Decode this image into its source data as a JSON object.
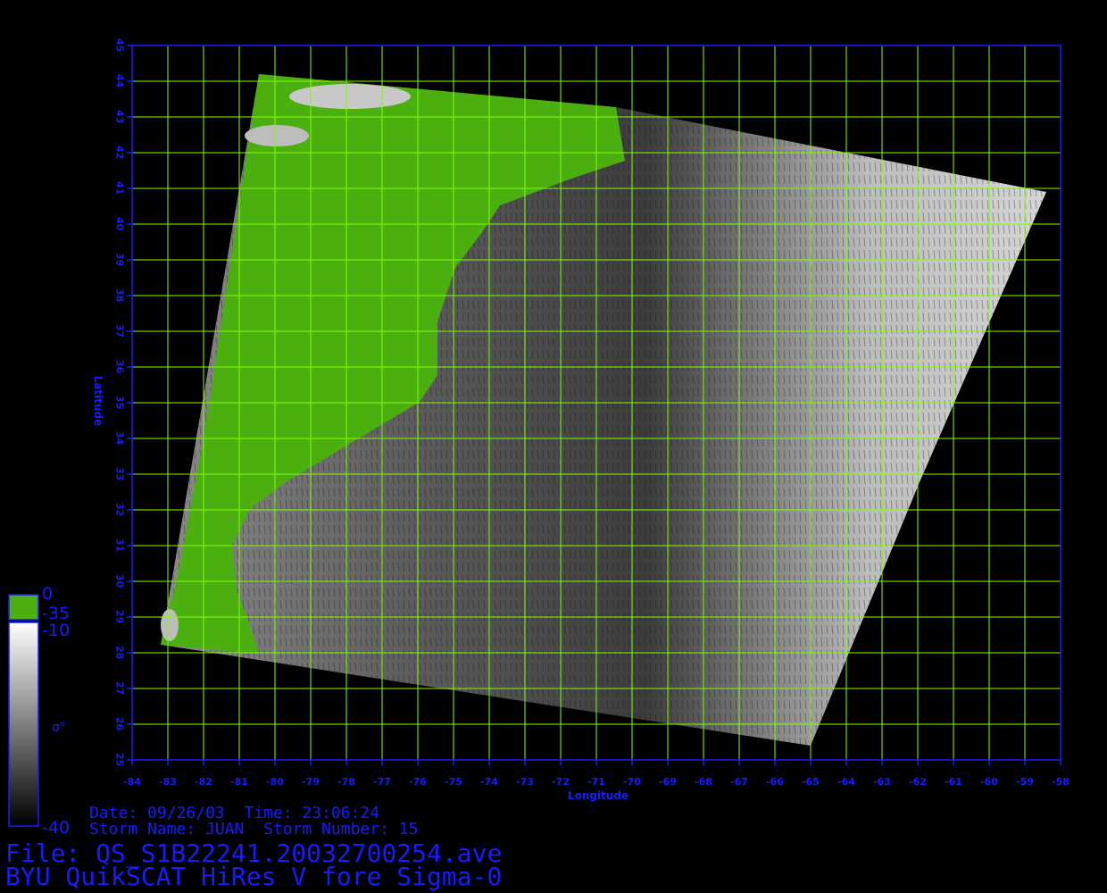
{
  "figure": {
    "xlabel": "Longitude",
    "ylabel": "Latitude",
    "x_ticks": [
      "-84",
      "-83",
      "-82",
      "-81",
      "-80",
      "-79",
      "-78",
      "-77",
      "-76",
      "-75",
      "-74",
      "-73",
      "-72",
      "-71",
      "-70",
      "-69",
      "-68",
      "-67",
      "-66",
      "-65",
      "-64",
      "-63",
      "-62",
      "-61",
      "-60",
      "-59",
      "-58"
    ],
    "y_ticks": [
      "45",
      "44",
      "43",
      "42",
      "41",
      "40",
      "39",
      "38",
      "37",
      "36",
      "35",
      "34",
      "33",
      "32",
      "31",
      "30",
      "29",
      "28",
      "27",
      "26",
      "25"
    ],
    "grid_color": "#7fff00",
    "axis_color": "#1a1aff"
  },
  "colorbar": {
    "top_label": "0",
    "land_label": "-35",
    "ocean_max_label": "-10",
    "bottom_label": "-40",
    "symbol_label": "σ°",
    "land_color": "#4caf10"
  },
  "info": {
    "date_line": "Date: 09/26/03  Time: 23:06:24",
    "storm_line": "Storm Name: JUAN  Storm Number: 15",
    "file_line": "File: QS_S1B22241.20032700254.ave",
    "title_line": "BYU QuikSCAT HiRes V fore Sigma-0"
  }
}
